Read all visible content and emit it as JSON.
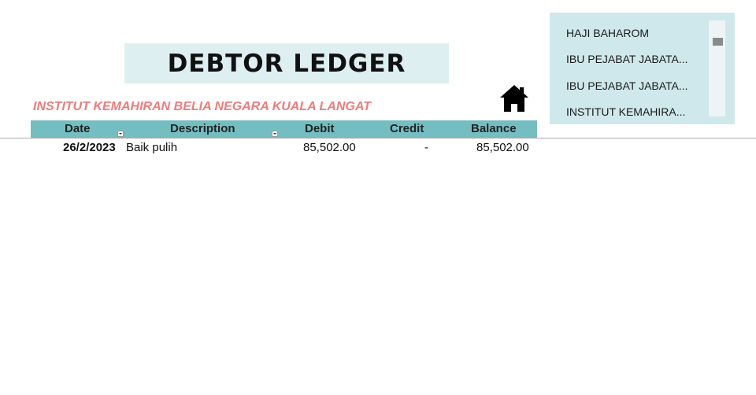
{
  "title": "DEBTOR LEDGER",
  "subtitle": "INSTITUT KEMAHIRAN BELIA NEGARA KUALA LANGAT",
  "home_icon": "home-icon",
  "table": {
    "headers": {
      "date": "Date",
      "description": "Description",
      "debit": "Debit",
      "credit": "Credit",
      "balance": "Balance"
    },
    "rows": [
      {
        "date": "26/2/2023",
        "description": "Baik pulih",
        "debit": "85,502.00",
        "credit": "-",
        "balance": "85,502.00"
      }
    ]
  },
  "slicer": {
    "items": [
      "HAJI BAHAROM",
      "IBU PEJABAT JABATA...",
      "IBU PEJABAT JABATA...",
      "INSTITUT KEMAHIRA..."
    ]
  },
  "colors": {
    "header_bg": "#74bec2",
    "title_bg": "#ddeff1",
    "slicer_bg": "#cfe8eb",
    "subtitle_color": "#ee7b7b"
  }
}
